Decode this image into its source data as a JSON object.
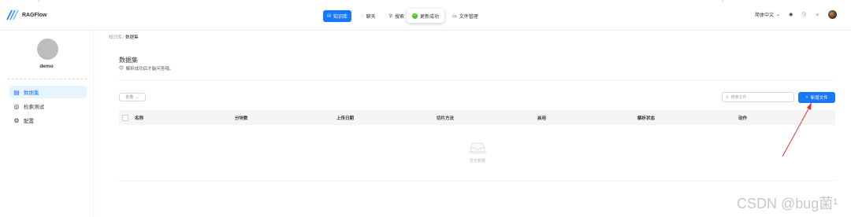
{
  "app": {
    "name": "RAGFlow"
  },
  "nav": {
    "items": [
      {
        "label": "知识库",
        "icon": "database-icon",
        "active": true
      },
      {
        "label": "聊天",
        "icon": "chat-icon",
        "active": false
      },
      {
        "label": "搜索",
        "icon": "search-icon",
        "active": false
      },
      {
        "label": "文件管理",
        "icon": "folder-icon",
        "active": false
      }
    ]
  },
  "toast": {
    "text": "更新成功",
    "icon": "success-check-icon",
    "color": "#52c41a"
  },
  "header_right": {
    "language": "简体中文"
  },
  "sidebar": {
    "user": "demo",
    "items": [
      {
        "label": "数据集",
        "icon": "file-icon",
        "active": true
      },
      {
        "label": "检索测试",
        "icon": "target-icon",
        "active": false
      },
      {
        "label": "配置",
        "icon": "gear-icon",
        "active": false
      }
    ]
  },
  "breadcrumb": {
    "root": "知识库",
    "separator": "/",
    "current": "数据集"
  },
  "page": {
    "title": "数据集",
    "description": "解析成功后才能问答哦。"
  },
  "toolbar": {
    "bulk_label": "批量",
    "search_placeholder": "搜索文件",
    "add_label": "新增文件"
  },
  "table": {
    "columns": [
      "名称",
      "分块数",
      "上传日期",
      "切片方法",
      "启用",
      "解析状态",
      "动作"
    ],
    "empty_text": "暂无数据"
  },
  "colors": {
    "primary": "#1677ff",
    "annotation_arrow": "#e8322e"
  },
  "watermark": "CSDN @bug菌¹"
}
